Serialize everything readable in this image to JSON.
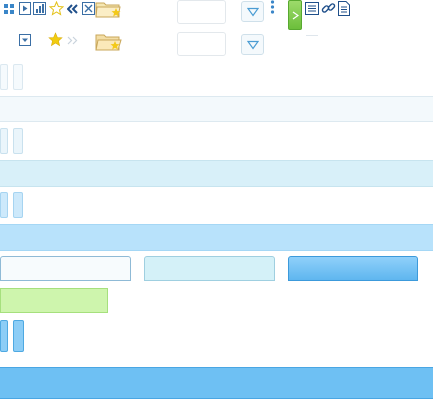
{
  "toolbar_row1": {
    "icons": [
      "grid-icon",
      "play-icon",
      "bar-chart-icon",
      "star-outline-icon",
      "double-left-icon",
      "close-box-icon",
      "folder-star-icon"
    ],
    "search_input": {
      "value": ""
    },
    "more_icon": "vertical-dots-icon",
    "right_icons": [
      "list-icon",
      "link-icon",
      "document-icon"
    ]
  },
  "toolbar_row2": {
    "icons": [
      "dropdown-box-icon",
      "star-filled-icon",
      "double-right-faded-icon",
      "folder-star-icon"
    ],
    "filter_input": {
      "value": ""
    }
  },
  "colors": {
    "row_light": "#f3f9fc",
    "row_cyan": "#d8f0f9",
    "row_sky": "#b8e2fb",
    "row_blue": "#6ec0f3",
    "green": "#cef5ad",
    "accent_green": "#6cbf3b"
  }
}
